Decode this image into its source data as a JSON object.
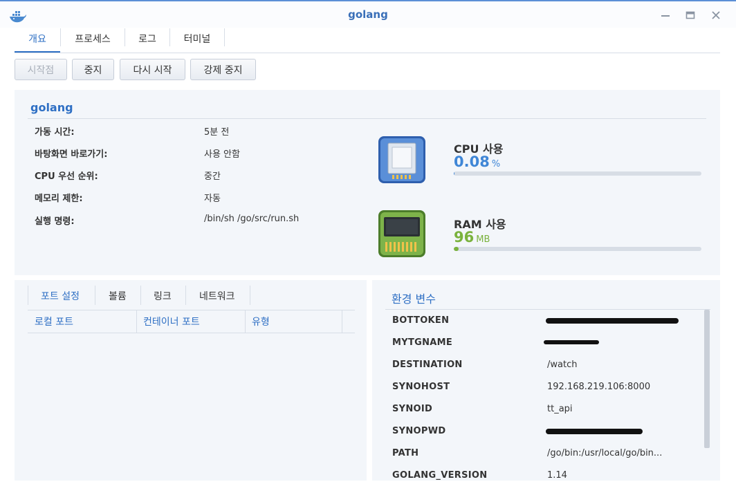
{
  "window": {
    "title": "golang",
    "icon": "docker-whale-icon",
    "controls": [
      "minimize-icon",
      "maximize-icon",
      "close-icon"
    ]
  },
  "tabs": [
    {
      "label": "개요",
      "active": true
    },
    {
      "label": "프로세스"
    },
    {
      "label": "로그"
    },
    {
      "label": "터미널"
    }
  ],
  "actions": {
    "start": "시작점",
    "stop": "중지",
    "restart": "다시 시작",
    "force_stop": "강제 중지"
  },
  "overview": {
    "name": "golang",
    "rows": [
      {
        "label": "가동 시간:",
        "value": "5분 전"
      },
      {
        "label": "바탕화면 바로가기:",
        "value": "사용 안함"
      },
      {
        "label": "CPU 우선 순위:",
        "value": "중간"
      },
      {
        "label": "메모리 제한:",
        "value": "자동"
      },
      {
        "label": "실행 명령:",
        "value": "/bin/sh /go/src/run.sh"
      }
    ],
    "cpu": {
      "title": "CPU 사용",
      "value": "0.08",
      "unit": "%",
      "fraction": 0.0008,
      "color": "#3f86d6"
    },
    "ram": {
      "title": "RAM 사용",
      "value": "96",
      "unit": "MB",
      "fraction": 0.02,
      "color": "#7ab23d"
    }
  },
  "ports": {
    "subtabs": [
      {
        "label": "포트 설정",
        "active": true
      },
      {
        "label": "볼륨"
      },
      {
        "label": "링크"
      },
      {
        "label": "네트워크"
      }
    ],
    "columns": [
      "로컬 포트",
      "컨테이너 포트",
      "유형"
    ]
  },
  "env": {
    "title": "환경 변수",
    "rows": [
      {
        "key": "BOTTOKEN",
        "value": ""
      },
      {
        "key": "MYTGNAME",
        "value": ""
      },
      {
        "key": "DESTINATION",
        "value": "/watch"
      },
      {
        "key": "SYNOHOST",
        "value": "192.168.219.106:8000"
      },
      {
        "key": "SYNOID",
        "value": "tt_api"
      },
      {
        "key": "SYNOPWD",
        "value": ""
      },
      {
        "key": "PATH",
        "value": "/go/bin:/usr/local/go/bin..."
      },
      {
        "key": "GOLANG_VERSION",
        "value": "1.14"
      }
    ]
  }
}
